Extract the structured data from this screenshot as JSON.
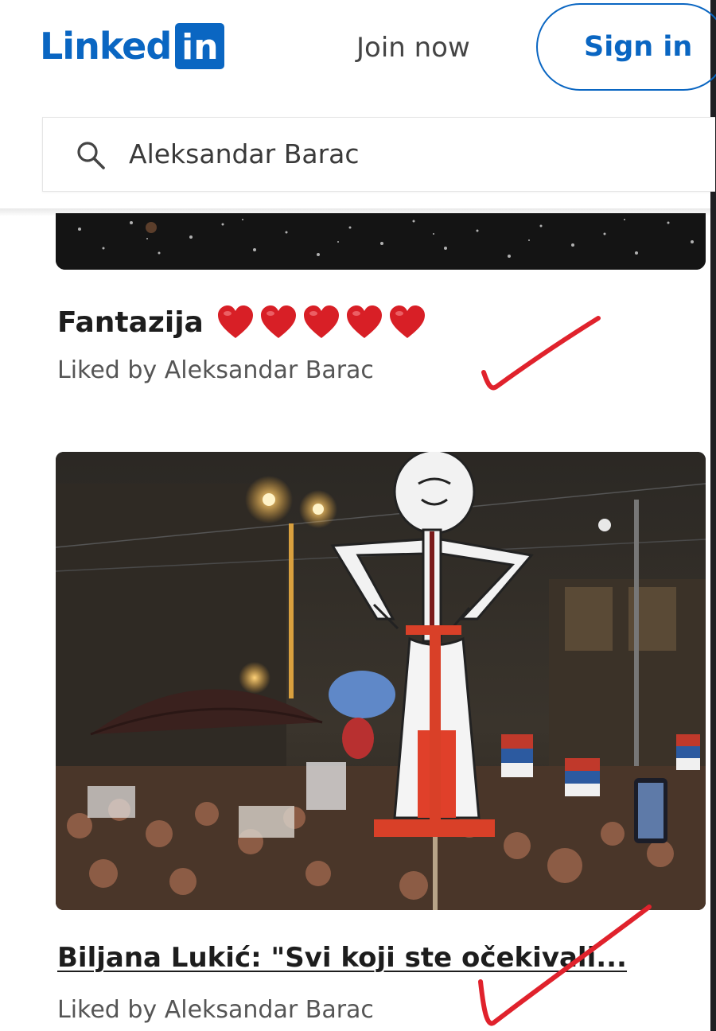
{
  "header": {
    "logo_word": "Linked",
    "logo_box": "in",
    "join_label": "Join now",
    "signin_label": "Sign in"
  },
  "search": {
    "icon": "search-icon",
    "value": "Aleksandar Barac"
  },
  "posts": [
    {
      "title": "Fantazija",
      "emoji_icons": [
        "heart-icon",
        "heart-icon",
        "heart-icon",
        "heart-icon",
        "heart-icon"
      ],
      "liked_by": "Liked by Aleksandar Barac"
    },
    {
      "title": "Biljana Lukić: \"Svi koji ste očekivali...",
      "liked_by": "Liked by Aleksandar Barac"
    }
  ],
  "colors": {
    "brand": "#0a66c2",
    "heart": "#d81f26",
    "checkmark": "#e0222c"
  }
}
